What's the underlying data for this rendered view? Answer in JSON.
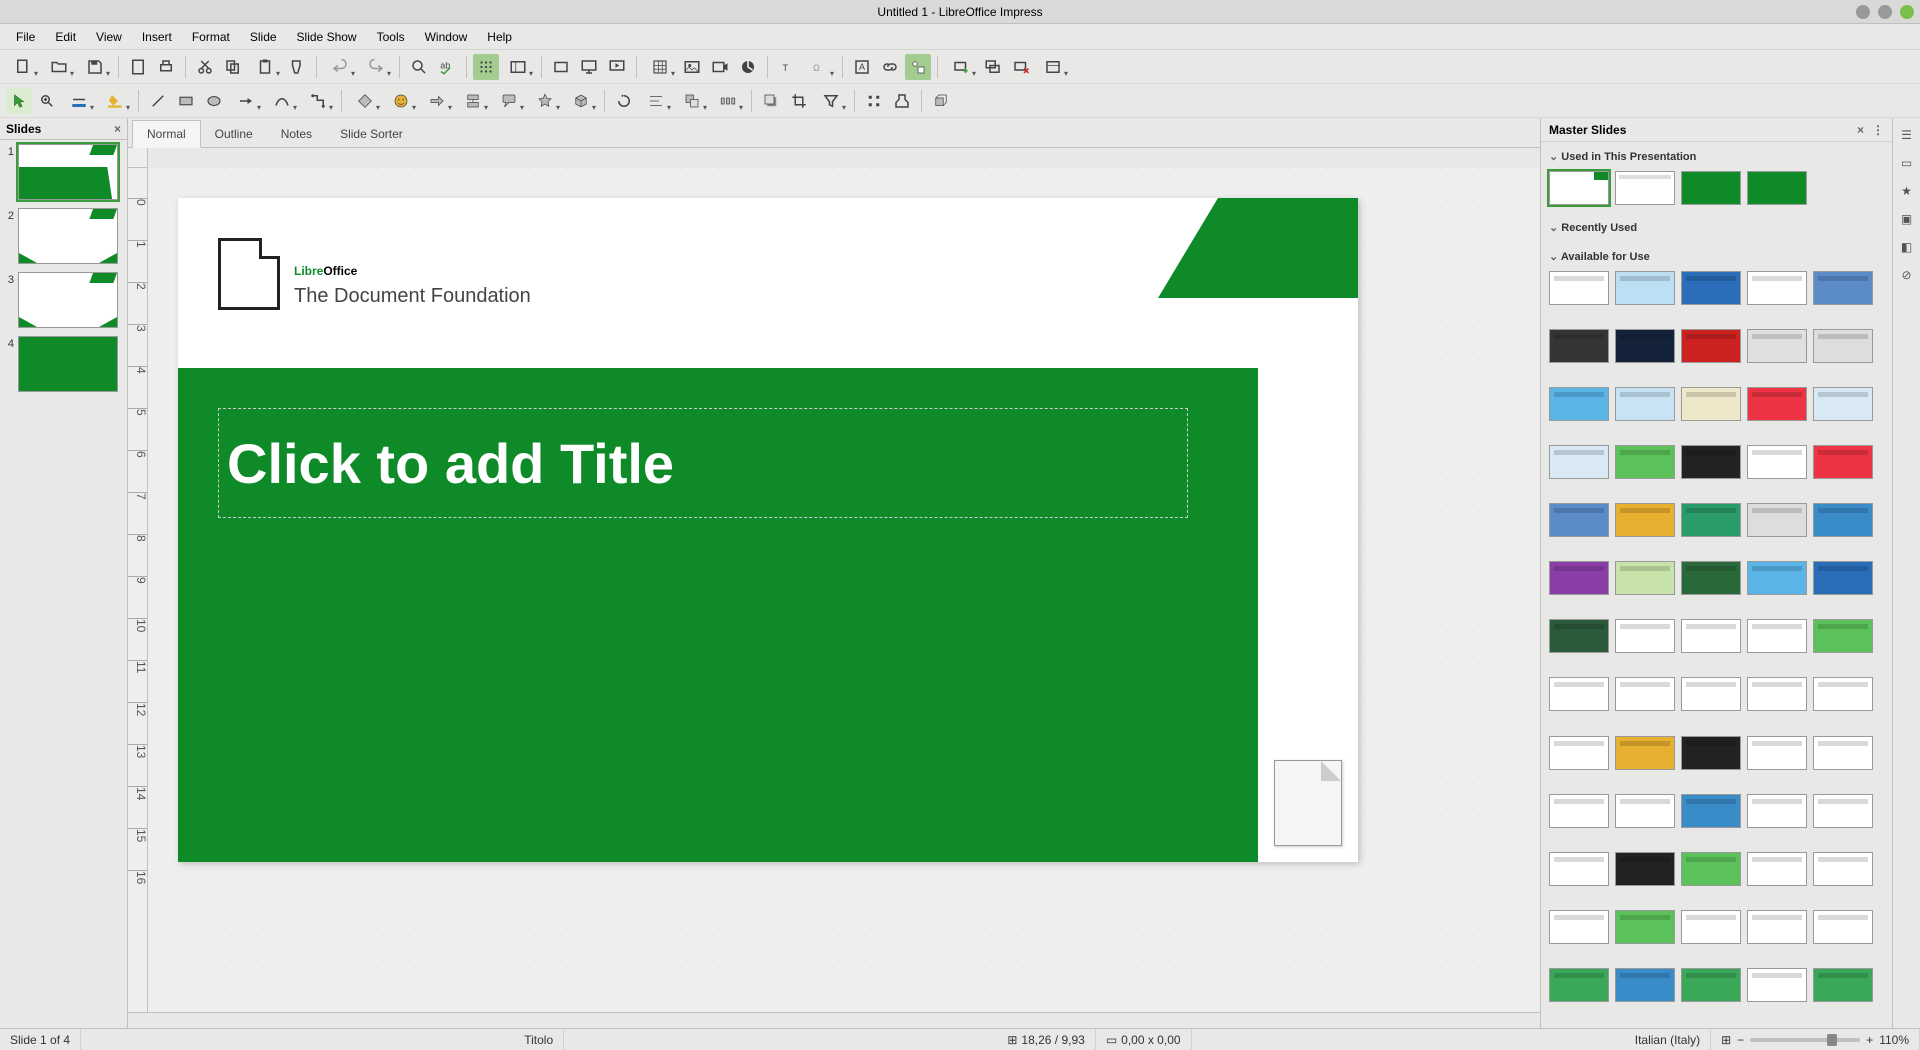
{
  "window": {
    "title": "Untitled 1 - LibreOffice Impress"
  },
  "menu": [
    "File",
    "Edit",
    "View",
    "Insert",
    "Format",
    "Slide",
    "Slide Show",
    "Tools",
    "Window",
    "Help"
  ],
  "viewtabs": [
    {
      "label": "Normal",
      "sel": true
    },
    {
      "label": "Outline"
    },
    {
      "label": "Notes"
    },
    {
      "label": "Slide Sorter"
    }
  ],
  "slidepanel": {
    "title": "Slides",
    "close": "×"
  },
  "slides": [
    1,
    2,
    3,
    4
  ],
  "slide": {
    "logo1": "Libre",
    "logo2": "Office",
    "tag": "The Document Foundation",
    "title_placeholder": "Click to add Title"
  },
  "masterpanel": {
    "title": "Master Slides",
    "close": "×",
    "sections": [
      "Used in This Presentation",
      "Recently Used",
      "Available for Use"
    ]
  },
  "status": {
    "page": "Slide 1 of 4",
    "obj": "Titolo",
    "pos": "18,26 / 9,93",
    "size": "0,00 x 0,00",
    "lang": "Italian (Italy)",
    "zoom": "110%"
  },
  "master_colors": [
    [
      "#fff",
      "#bcdff4",
      "#2a6db8",
      "#fff",
      "#5b8bc9"
    ],
    [
      "#353535",
      "#14233a",
      "#c22",
      "#e0e0e0",
      "#ddd"
    ],
    [
      "#5bb4e8",
      "#c8e3f4",
      "#efe7c9",
      "#e34",
      "#d8e8f4"
    ],
    [
      "#d8e8f4",
      "#5bc25b",
      "#222",
      "#fff",
      "#e34"
    ],
    [
      "#5b8bc9",
      "#e8b030",
      "#2a9c6a",
      "#ddd",
      "#3a8cc9"
    ],
    [
      "#8a3fa8",
      "#c8e3aa",
      "#2a6a3a",
      "#5bb4e8",
      "#2a6db8"
    ],
    [
      "#2a5a3a",
      "#fff",
      "#fff",
      "#fff",
      "#5bc25b"
    ],
    [
      "#fff",
      "#fff",
      "#fff",
      "#fff",
      "#fff"
    ],
    [
      "#fff",
      "#e8b030",
      "#222",
      "#fff",
      "#fff"
    ],
    [
      "#fff",
      "#fff",
      "#3a8cc9",
      "#fff",
      "#fff"
    ],
    [
      "#fff",
      "#222",
      "#5bc25b",
      "#fff",
      "#fff"
    ],
    [
      "#fff",
      "#5bc25b",
      "#fff",
      "#fff",
      "#fff"
    ],
    [
      "#3aa858",
      "#3a8cc9",
      "#3aa858",
      "#fff",
      "#3aa858"
    ]
  ]
}
